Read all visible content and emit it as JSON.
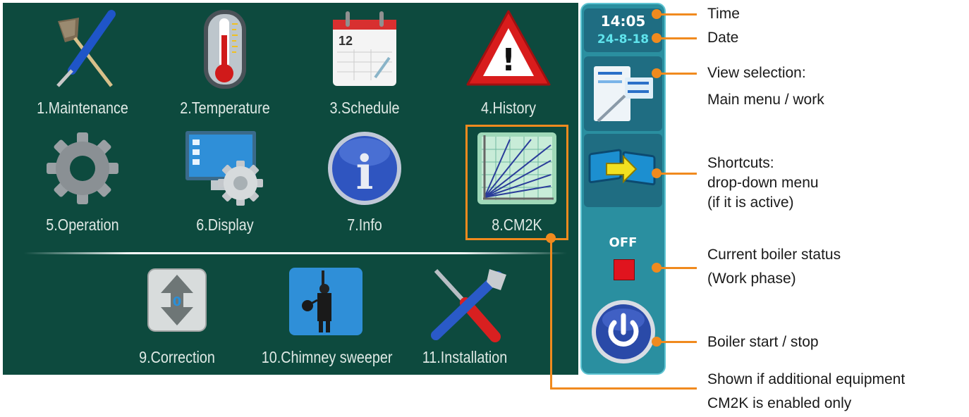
{
  "screen": {
    "menu_items": [
      {
        "label": "1.Maintenance",
        "icon": "tools-icon"
      },
      {
        "label": "2.Temperature",
        "icon": "thermometer-icon"
      },
      {
        "label": "3.Schedule",
        "icon": "calendar-icon",
        "calendar_day": "12"
      },
      {
        "label": "4.History",
        "icon": "warning-icon",
        "mark": "!"
      },
      {
        "label": "5.Operation",
        "icon": "gear-icon"
      },
      {
        "label": "6.Display",
        "icon": "display-gear-icon"
      },
      {
        "label": "7.Info",
        "icon": "info-icon",
        "mark": "i"
      },
      {
        "label": "8.CM2K",
        "icon": "cm2k-chart-icon"
      },
      {
        "label": "9.Correction",
        "icon": "correction-arrows-icon",
        "value": "0"
      },
      {
        "label": "10.Chimney sweeper",
        "icon": "chimney-sweeper-icon"
      },
      {
        "label": "11.Installation",
        "icon": "screwdriver-wrench-icon"
      }
    ]
  },
  "sidebar": {
    "time": "14:05",
    "date": "24-8-18",
    "view_selection_icon": "view-selection-icon",
    "shortcuts_icon": "shortcuts-icon",
    "status_text": "OFF",
    "status_color": "#e0141e",
    "power_icon": "power-icon"
  },
  "annotations": {
    "time": "Time",
    "date": "Date",
    "view_selection": [
      "View selection:",
      "Main menu / work"
    ],
    "shortcuts": [
      "Shortcuts:",
      "drop-down menu",
      "(if it is active)"
    ],
    "boiler_status": [
      "Current boiler status",
      "(Work phase)"
    ],
    "start_stop": "Boiler start / stop",
    "cm2k_note": [
      "Shown if additional equipment",
      "CM2K  is enabled only"
    ]
  },
  "colors": {
    "screen_bg": "#0d4a3e",
    "sidebar_bg": "#2a8fa0",
    "accent": "#f08a1e",
    "time_color": "#ffffff",
    "date_color": "#5fe3ec"
  }
}
